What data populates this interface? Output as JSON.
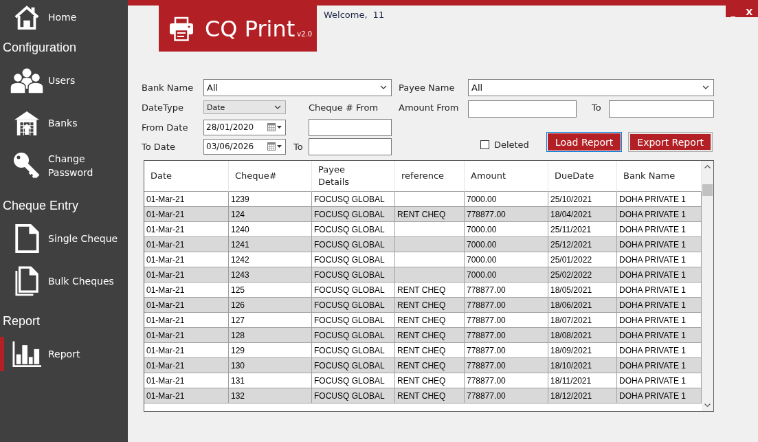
{
  "sidebar": {
    "sections": [
      {
        "items": [
          {
            "label": "Home",
            "kind": "home",
            "selected": false
          }
        ]
      },
      {
        "heading": "Configuration",
        "items": [
          {
            "label": "Users",
            "kind": "users",
            "selected": false
          },
          {
            "label": "Banks",
            "kind": "bank",
            "selected": false
          },
          {
            "label": "Change Password",
            "kind": "key",
            "selected": false
          }
        ]
      },
      {
        "heading": "Cheque Entry",
        "items": [
          {
            "label": "Single Cheque",
            "kind": "document",
            "selected": false
          },
          {
            "label": "Bulk Cheques",
            "kind": "documents",
            "selected": false
          }
        ]
      },
      {
        "heading": "Report",
        "items": [
          {
            "label": "Report",
            "kind": "chart",
            "selected": true
          }
        ]
      }
    ]
  },
  "header": {
    "logo": {
      "title": "CQ Print",
      "version": "v2.0"
    },
    "welcome": {
      "label": "Welcome,",
      "user": "11"
    },
    "window_controls": {
      "minimize": "_",
      "close": "X"
    }
  },
  "filters": {
    "bank_name": {
      "label": "Bank Name",
      "value": "All"
    },
    "payee_name": {
      "label": "Payee Name",
      "value": "All"
    },
    "date_type": {
      "label": "DateType",
      "value": "Date"
    },
    "cheque_from": {
      "label": "Cheque # From"
    },
    "amount_from": {
      "label": "Amount From"
    },
    "amount_to": {
      "label": "To"
    },
    "from_date": {
      "label": "From Date",
      "value": "28/01/2020"
    },
    "to_date": {
      "label": "To Date",
      "value": "03/06/2026"
    },
    "cheque_to": {
      "label": "To"
    },
    "deleted": {
      "label": "Deleted",
      "checked": false
    },
    "buttons": [
      {
        "label": "Load Report",
        "focused": true
      },
      {
        "label": "Export Report",
        "focused": false
      }
    ]
  },
  "table": {
    "columns": [
      "Date",
      "Cheque#",
      "Payee Details",
      "reference",
      "Amount",
      "DueDate",
      "Bank Name"
    ],
    "rows": [
      {
        "date": "01-Mar-21",
        "cheque": "1239",
        "payee": "FOCUSQ GLOBAL",
        "amount": "7000.00",
        "due_date": "25/10/2021",
        "bank": "DOHA PRIVATE 1"
      },
      {
        "date": "01-Mar-21",
        "cheque": "124",
        "payee": "FOCUSQ GLOBAL",
        "reference": "RENT CHEQ",
        "amount": "778877.00",
        "due_date": "18/04/2021",
        "bank": "DOHA PRIVATE 1"
      },
      {
        "date": "01-Mar-21",
        "cheque": "1240",
        "payee": "FOCUSQ GLOBAL",
        "amount": "7000.00",
        "due_date": "25/11/2021",
        "bank": "DOHA PRIVATE 1"
      },
      {
        "date": "01-Mar-21",
        "cheque": "1241",
        "payee": "FOCUSQ GLOBAL",
        "amount": "7000.00",
        "due_date": "25/12/2021",
        "bank": "DOHA PRIVATE 1"
      },
      {
        "date": "01-Mar-21",
        "cheque": "1242",
        "payee": "FOCUSQ GLOBAL",
        "amount": "7000.00",
        "due_date": "25/01/2022",
        "bank": "DOHA PRIVATE 1"
      },
      {
        "date": "01-Mar-21",
        "cheque": "1243",
        "payee": "FOCUSQ GLOBAL",
        "amount": "7000.00",
        "due_date": "25/02/2022",
        "bank": "DOHA PRIVATE 1"
      },
      {
        "date": "01-Mar-21",
        "cheque": "125",
        "payee": "FOCUSQ GLOBAL",
        "reference": "RENT CHEQ",
        "amount": "778877.00",
        "due_date": "18/05/2021",
        "bank": "DOHA PRIVATE 1"
      },
      {
        "date": "01-Mar-21",
        "cheque": "126",
        "payee": "FOCUSQ GLOBAL",
        "reference": "RENT CHEQ",
        "amount": "778877.00",
        "due_date": "18/06/2021",
        "bank": "DOHA PRIVATE 1"
      },
      {
        "date": "01-Mar-21",
        "cheque": "127",
        "payee": "FOCUSQ GLOBAL",
        "reference": "RENT CHEQ",
        "amount": "778877.00",
        "due_date": "18/07/2021",
        "bank": "DOHA PRIVATE 1"
      },
      {
        "date": "01-Mar-21",
        "cheque": "128",
        "payee": "FOCUSQ GLOBAL",
        "reference": "RENT CHEQ",
        "amount": "778877.00",
        "due_date": "18/08/2021",
        "bank": "DOHA PRIVATE 1"
      },
      {
        "date": "01-Mar-21",
        "cheque": "129",
        "payee": "FOCUSQ GLOBAL",
        "reference": "RENT CHEQ",
        "amount": "778877.00",
        "due_date": "18/09/2021",
        "bank": "DOHA PRIVATE 1"
      },
      {
        "date": "01-Mar-21",
        "cheque": "130",
        "payee": "FOCUSQ GLOBAL",
        "reference": "RENT CHEQ",
        "amount": "778877.00",
        "due_date": "18/10/2021",
        "bank": "DOHA PRIVATE 1"
      },
      {
        "date": "01-Mar-21",
        "cheque": "131",
        "payee": "FOCUSQ GLOBAL",
        "reference": "RENT CHEQ",
        "amount": "778877.00",
        "due_date": "18/11/2021",
        "bank": "DOHA PRIVATE 1"
      },
      {
        "date": "01-Mar-21",
        "cheque": "132",
        "payee": "FOCUSQ GLOBAL",
        "reference": "RENT CHEQ",
        "amount": "778877.00",
        "due_date": "18/12/2021",
        "bank": "DOHA PRIVATE 1"
      }
    ]
  }
}
